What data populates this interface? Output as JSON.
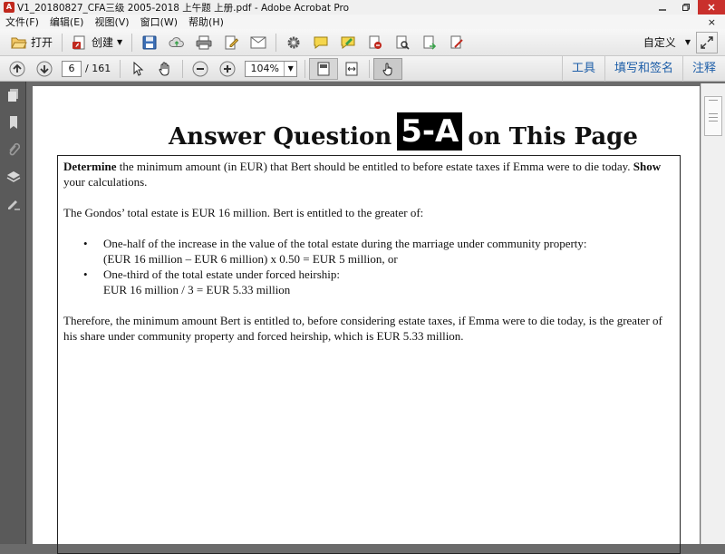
{
  "window": {
    "title": "V1_20180827_CFA三级 2005-2018 上午题 上册.pdf - Adobe Acrobat Pro",
    "app_icon_label": "A"
  },
  "menu": {
    "items": [
      "文件(F)",
      "编辑(E)",
      "视图(V)",
      "窗口(W)",
      "帮助(H)"
    ],
    "close_glyph": "×"
  },
  "toolbar1": {
    "open_label": "打开",
    "create_label": "创建",
    "customize_label": "自定义"
  },
  "toolbar2": {
    "current_page": "6",
    "total_pages": "/ 161",
    "zoom": "104%",
    "links": [
      "工具",
      "填写和签名",
      "注释"
    ]
  },
  "document": {
    "heading_pre": "Answer Question",
    "heading_highlight": "5-A",
    "heading_post": "on This Page",
    "q_bold1": "Determine",
    "q_text1": " the minimum amount (in EUR) that Bert should be entitled to before estate taxes if Emma were to die today. ",
    "q_bold2": "Show",
    "q_text2": " your calculations.",
    "para1": "The Gondos’ total estate is EUR 16 million. Bert is entitled to the greater of:",
    "bullet1_line1": "One-half of the increase in the value of the total estate during the marriage under community property:",
    "bullet1_line2": "(EUR 16 million – EUR 6 million) x 0.50 = EUR 5 million, or",
    "bullet2_line1": "One-third of the total estate under forced heirship:",
    "bullet2_line2": "EUR 16 million / 3 = EUR 5.33 million",
    "para2": "Therefore, the minimum amount Bert is entitled to, before considering estate taxes, if Emma were to die today, is the greater of his share under community property and forced heirship, which is EUR 5.33 million."
  },
  "colors": {
    "accent_link": "#1d5ea8",
    "close_red": "#c9302c",
    "pdf_red": "#c0281d"
  }
}
